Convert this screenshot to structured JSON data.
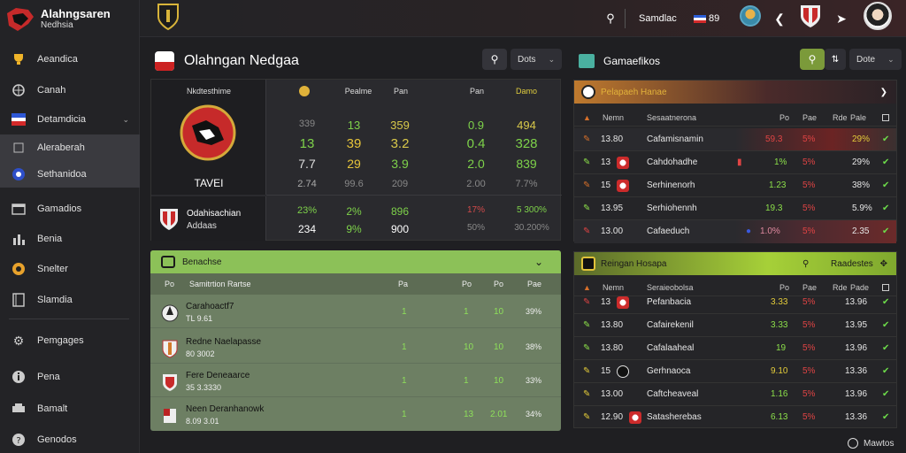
{
  "brand": {
    "title": "Alahngsaren",
    "subtitle": "Nedhsia"
  },
  "sidebar": {
    "items": [
      {
        "label": "Aeandica",
        "icon": "trophy-icon"
      },
      {
        "label": "Canah",
        "icon": "globe-icon"
      },
      {
        "label": "Detamdicia",
        "icon": "flag-icon"
      },
      {
        "label": "Aleraberah",
        "icon": "fire-icon"
      },
      {
        "label": "Sethanidoa",
        "icon": "shield-icon"
      },
      {
        "label": "Gamadios",
        "icon": "calendar-icon"
      },
      {
        "label": "Benia",
        "icon": "chart-icon"
      },
      {
        "label": "Snelter",
        "icon": "coin-icon"
      },
      {
        "label": "Slamdia",
        "icon": "book-icon"
      },
      {
        "label": "Pemgages",
        "icon": "gear-icon"
      },
      {
        "label": "Pena",
        "icon": "info-icon"
      },
      {
        "label": "Bamalt",
        "icon": "print-icon"
      },
      {
        "label": "Genodos",
        "icon": "help-icon"
      }
    ]
  },
  "topbar": {
    "label": "Samdlac",
    "flag_text": "89"
  },
  "main": {
    "title": "Olahngan Nedgaa",
    "filter_label": "Dots"
  },
  "stats": {
    "team_name": "Nkdtesthime",
    "team_label": "TAVEI",
    "col_heads": [
      "Pealme",
      "Pan",
      "Pan",
      "Damo"
    ],
    "rows": [
      [
        "339",
        "13",
        "359",
        "0.9",
        "494"
      ],
      [
        "13",
        "39",
        "3.2",
        "0.4",
        "328"
      ],
      [
        "7.7",
        "29",
        "3.9",
        "2.0",
        "839"
      ],
      [
        "2.74",
        "99.6",
        "209",
        "2.00",
        "7.7%"
      ]
    ],
    "bottom": {
      "name": "Odahisachian",
      "sub": "Addaas",
      "values": [
        "23%",
        "2%",
        "896",
        "17%",
        "5 300%"
      ],
      "values2": [
        "234",
        "9%",
        "900",
        "50%",
        "30.200%"
      ]
    }
  },
  "lineup": {
    "title": "Benachse",
    "sub_cols": [
      "Po",
      "Samitrtion Rartse",
      "Pa",
      "Po",
      "Po",
      "Pae"
    ],
    "rows": [
      {
        "name": "Carahoactf7",
        "sub": "TL 9.61",
        "values": [
          "1",
          "1",
          "10",
          "39%"
        ]
      },
      {
        "name": "Redne Naelapasse",
        "sub": "80 3002",
        "values": [
          "1",
          "10",
          "10",
          "38%"
        ]
      },
      {
        "name": "Fere Deneaarce",
        "sub": "35 3.3330",
        "values": [
          "1",
          "1",
          "10",
          "33%"
        ]
      },
      {
        "name": "Neen Deranhanowk",
        "sub": "8.09 3.01",
        "values": [
          "1",
          "13",
          "2.01",
          "34%"
        ]
      }
    ]
  },
  "tableA": {
    "title": "Gamaefikos",
    "filter_label": "Dote",
    "header": "Pelapaeh Hanae",
    "cols": [
      "Nemn",
      "Sesaatnerona",
      "Po",
      "Pae",
      "Rde",
      "Pale"
    ],
    "rows": [
      {
        "rank": "13.80",
        "name": "Cafamisnamin",
        "v1": "59.3",
        "v2": "5%",
        "v3": "29%"
      },
      {
        "rank": "13",
        "name": "Cahdohadhe",
        "v1": "1%",
        "v2": "5%",
        "v3": "29%"
      },
      {
        "rank": "15",
        "name": "Serhinenorh",
        "v1": "1.23",
        "v2": "5%",
        "v3": "38%"
      },
      {
        "rank": "13.95",
        "name": "Serhiohennh",
        "v1": "19.3",
        "v2": "5%",
        "v3": "5.9%"
      },
      {
        "rank": "13.00",
        "name": "Cafaeduch",
        "v1": "1.0%",
        "v2": "5%",
        "v3": "2.35"
      }
    ]
  },
  "tableB": {
    "title": "Reingan Hosapa",
    "filter_label": "Raadestes",
    "cols": [
      "Nemn",
      "Seraieobolsa",
      "Po",
      "Pae",
      "Rde",
      "Pade"
    ],
    "rows": [
      {
        "rank": "13",
        "name": "Pefanbacia",
        "v1": "3.33",
        "v2": "5%",
        "v3": "13.96"
      },
      {
        "rank": "13.80",
        "name": "Cafairekenil",
        "v1": "3.33",
        "v2": "5%",
        "v3": "13.95"
      },
      {
        "rank": "13.80",
        "name": "Cafalaaheal",
        "v1": "19",
        "v2": "5%",
        "v3": "13.96"
      },
      {
        "rank": "15",
        "name": "Gerhnaoca",
        "v1": "9.10",
        "v2": "5%",
        "v3": "13.36"
      },
      {
        "rank": "13.00",
        "name": "Caftcheaveal",
        "v1": "1.16",
        "v2": "5%",
        "v3": "13.96"
      },
      {
        "rank": "12.90",
        "name": "Satasherebas",
        "v1": "6.13",
        "v2": "5%",
        "v3": "13.36"
      }
    ]
  },
  "footer": {
    "label": "Mawtos"
  }
}
